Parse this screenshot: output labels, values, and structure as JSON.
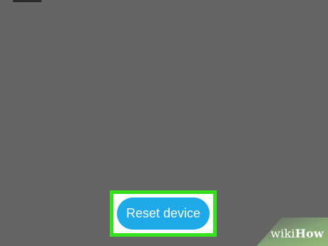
{
  "screen": {
    "background_color": "#646464"
  },
  "reset_button": {
    "label": "Reset device",
    "color": "#1ea9e8",
    "text_color": "#ffffff",
    "highlight_color": "#33e11d"
  },
  "watermark": {
    "part1": "wiki",
    "part2": "How"
  }
}
